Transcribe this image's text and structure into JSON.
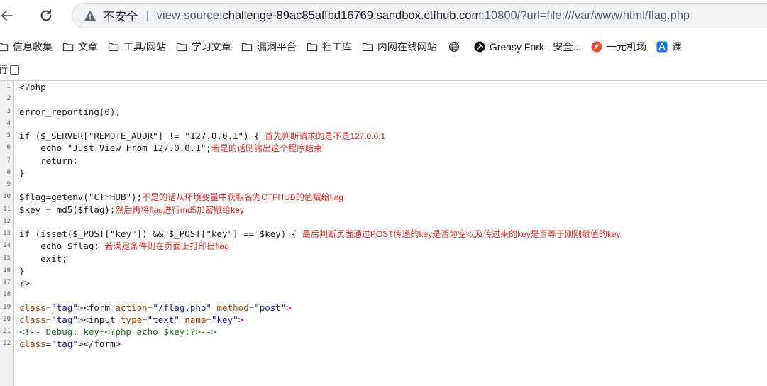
{
  "browser": {
    "insecure_label": "不安全",
    "url_prefix": "view-source:",
    "url_host": "challenge-89ac85affbd16769.sandbox.ctfhub.com",
    "url_rest": ":10800/?url=file:///var/www/html/flag.php"
  },
  "bookmarks": [
    {
      "label": "信息收集",
      "icon": "folder-icon"
    },
    {
      "label": "文章",
      "icon": "folder-icon"
    },
    {
      "label": "工具/网站",
      "icon": "folder-icon"
    },
    {
      "label": "学习文章",
      "icon": "folder-icon"
    },
    {
      "label": "漏洞平台",
      "icon": "folder-icon"
    },
    {
      "label": "社工库",
      "icon": "folder-icon"
    },
    {
      "label": "内网在线网站",
      "icon": "folder-icon"
    },
    {
      "label": "",
      "icon": "globe-icon"
    },
    {
      "label": "Greasy Fork - 安全...",
      "icon": "greasyfork-icon"
    },
    {
      "label": "一元机场",
      "icon": "airport-icon"
    },
    {
      "label": "课",
      "icon": "ai-icon"
    }
  ],
  "wrap_label": "行",
  "source_lines": [
    {
      "n": "1",
      "code": "<?php",
      "note": ""
    },
    {
      "n": "2",
      "code": "",
      "note": ""
    },
    {
      "n": "3",
      "code": "error_reporting(0);",
      "note": ""
    },
    {
      "n": "4",
      "code": "",
      "note": ""
    },
    {
      "n": "5",
      "code": "if ($_SERVER[\"REMOTE_ADDR\"] != \"127.0.0.1\") { ",
      "note": "首先判断请求的是不是127.0.0.1"
    },
    {
      "n": "6",
      "code": "    echo \"Just View From 127.0.0.1\";",
      "note": "若是的话则输出这个程序结束"
    },
    {
      "n": "7",
      "code": "    return;",
      "note": ""
    },
    {
      "n": "8",
      "code": "}",
      "note": ""
    },
    {
      "n": "9",
      "code": "",
      "note": ""
    },
    {
      "n": "10",
      "code": "$flag=getenv(\"CTFHUB\");",
      "note": "不是的话从环境变量中获取名为CTFHUB的值赋给flag"
    },
    {
      "n": "11",
      "code": "$key = md5($flag);",
      "note": "然后再将flag进行md5加密赋给key"
    },
    {
      "n": "12",
      "code": "",
      "note": ""
    },
    {
      "n": "13",
      "code": "if (isset($_POST[\"key\"]) && $_POST[\"key\"] == $key) { ",
      "note": "最后判断页面通过POST传递的key是否为空以及传过来的key是否等于刚刚赋值的key"
    },
    {
      "n": "14",
      "code": "    echo $flag; ",
      "note": "若满足条件则在页面上打印出flag"
    },
    {
      "n": "15",
      "code": "    exit;",
      "note": ""
    },
    {
      "n": "16",
      "code": "}",
      "note": ""
    },
    {
      "n": "17",
      "code": "?>",
      "note": ""
    },
    {
      "n": "18",
      "code": "",
      "note": ""
    },
    {
      "n": "19",
      "code": "<form action=\"/flag.php\" method=\"post\">",
      "note": ""
    },
    {
      "n": "20",
      "code": "<input type=\"text\" name=\"key\">",
      "note": ""
    },
    {
      "n": "21",
      "code": "<!-- Debug: key=<?php echo $key;?>-->",
      "note": ""
    },
    {
      "n": "22",
      "code": "</form>",
      "note": ""
    }
  ]
}
